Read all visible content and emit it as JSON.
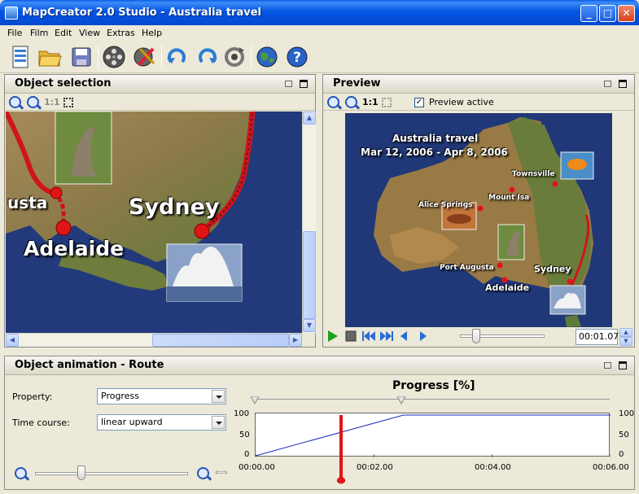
{
  "window": {
    "title": "MapCreator 2.0 Studio - Australia travel"
  },
  "menu": [
    "File",
    "Film",
    "Edit",
    "View",
    "Extras",
    "Help"
  ],
  "toolbar": {
    "icons": [
      "film-list-icon",
      "open-folder-icon",
      "save-disk-icon",
      "film-reel-icon",
      "film-tools-icon",
      "undo-icon",
      "redo-icon",
      "cycle-icon",
      "globe-icon",
      "help-icon"
    ]
  },
  "object_selection": {
    "title": "Object selection",
    "zoom_label": "1:1",
    "labels": {
      "sydney": "Sydney",
      "adelaide": "Adelaide",
      "usta": "usta"
    }
  },
  "preview": {
    "title": "Preview",
    "zoom_label": "1:1",
    "preview_active_label": "Preview active",
    "preview_active": true,
    "map_title": "Australia travel",
    "map_dates": "Mar 12, 2006 - Apr 8, 2006",
    "cities": {
      "townsville": "Townsville",
      "mount_isa": "Mount Isa",
      "alice_springs": "Alice Springs",
      "port_augusta": "Port Augusta",
      "sydney": "Sydney",
      "adelaide": "Adelaide"
    },
    "time": "00:01.07"
  },
  "object_animation": {
    "title": "Object animation - Route",
    "property_label": "Property:",
    "property_value": "Progress",
    "time_course_label": "Time course:",
    "time_course_value": "linear upward",
    "graph_title": "Progress [%]",
    "y_ticks": [
      "100",
      "50",
      "0"
    ],
    "x_ticks": [
      "00:00.00",
      "00:02.00",
      "00:04.00",
      "00:06.00"
    ]
  },
  "chart_data": {
    "type": "line",
    "x": [
      0,
      2.5,
      6
    ],
    "y": [
      0,
      100,
      100
    ],
    "xlim": [
      0,
      6
    ],
    "ylim": [
      0,
      100
    ],
    "cursor_x": 1.45
  }
}
